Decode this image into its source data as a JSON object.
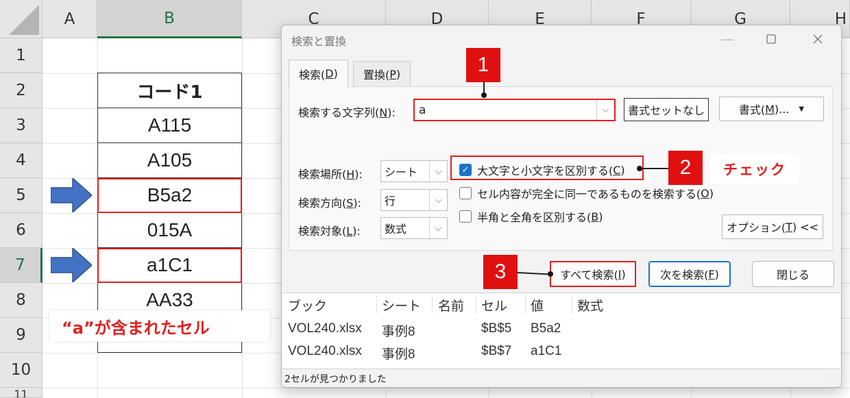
{
  "sheet": {
    "columns": [
      "A",
      "B",
      "C",
      "D",
      "E",
      "F",
      "G",
      "H"
    ],
    "rows": [
      "1",
      "2",
      "3",
      "4",
      "5",
      "6",
      "7",
      "8",
      "9",
      "10",
      "11"
    ],
    "cells": [
      "コード1",
      "A115",
      "A105",
      "B5a2",
      "015A",
      "a1C1",
      "AA33"
    ],
    "note": "“a”が含まれたセル"
  },
  "dialog": {
    "title": "検索と置換",
    "tabs": [
      {
        "label": "検索(",
        "key": "D",
        "tail": ")"
      },
      {
        "label": "置換(",
        "key": "P",
        "tail": ")"
      }
    ],
    "find_label": {
      "label": "検索する文字列(",
      "key": "N",
      "tail": "):"
    },
    "find_value": "a",
    "no_format_button": "書式セットなし",
    "format_button": {
      "label": "書式(",
      "key": "M",
      "tail": ")..."
    },
    "within": {
      "label": "検索場所(",
      "key": "H",
      "tail": "):",
      "value": "シート"
    },
    "search": {
      "label": "検索方向(",
      "key": "S",
      "tail": "):",
      "value": "行"
    },
    "look_in": {
      "label": "検索対象(",
      "key": "L",
      "tail": "):",
      "value": "数式"
    },
    "checkboxes": [
      {
        "label": "大文字と小文字を区別する(",
        "key": "C",
        "tail": ")",
        "checked": true
      },
      {
        "label": "セル内容が完全に同一であるものを検索する(",
        "key": "O",
        "tail": ")",
        "checked": false
      },
      {
        "label": "半角と全角を区別する(",
        "key": "B",
        "tail": ")",
        "checked": false
      }
    ],
    "options_button": {
      "label": "オプション(",
      "key": "T",
      "tail": ") <<"
    },
    "find_all_button": {
      "label": "すべて検索(",
      "key": "I",
      "tail": ")"
    },
    "find_next_button": {
      "label": "次を検索(",
      "key": "F",
      "tail": ")"
    },
    "close_button": "閉じる",
    "results": {
      "headers": [
        "ブック",
        "シート",
        "名前",
        "セル",
        "値",
        "数式"
      ],
      "rows": [
        {
          "book": "VOL240.xlsx",
          "sheet": "事例8",
          "name": "",
          "cell": "$B$5",
          "value": "B5a2",
          "formula": ""
        },
        {
          "book": "VOL240.xlsx",
          "sheet": "事例8",
          "name": "",
          "cell": "$B$7",
          "value": "a1C1",
          "formula": ""
        }
      ]
    },
    "status": "2セルが見つかりました"
  },
  "callouts": {
    "badge1": "1",
    "badge2": "2",
    "badge3": "3",
    "check_note": "チェック"
  },
  "colors": {
    "highlight": "#e02020",
    "badge": "#e01010",
    "arrow": "#4472c4",
    "excel_green": "#217346"
  }
}
